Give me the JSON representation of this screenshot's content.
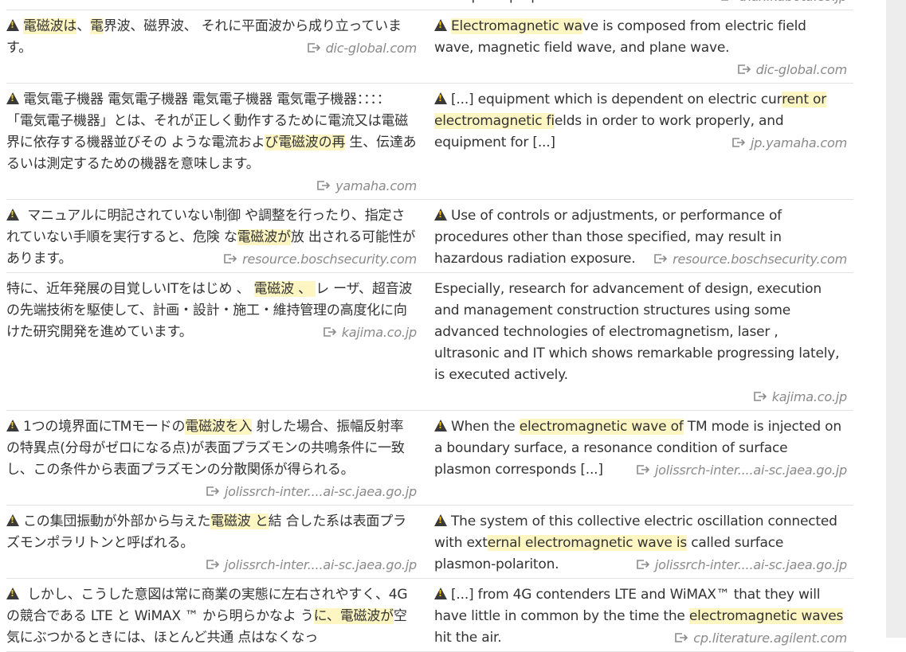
{
  "rows": [
    {
      "ja": {
        "warn": false,
        "segments": [],
        "source": ""
      },
      "en": {
        "warn": false,
        "segments": [
          {
            "t": "absorption properties and the like.",
            "h": false
          }
        ],
        "source": "txax.kubota.co.jp"
      }
    },
    {
      "ja": {
        "warn": true,
        "segments": [
          {
            "t": "電磁波は",
            "h": true
          },
          {
            "t": "、",
            "h": false
          },
          {
            "t": "電",
            "h": true
          },
          {
            "t": "界波、磁界波、 それに平面波から成り立っています。",
            "h": false
          }
        ],
        "source": "dic-global.com"
      },
      "en": {
        "warn": true,
        "segments": [
          {
            "t": "Electromagnetic wa",
            "h": true
          },
          {
            "t": "ve is composed from electric field wave, magnetic field wave, and plane wave.",
            "h": false
          }
        ],
        "source": "dic-global.com"
      }
    },
    {
      "ja": {
        "warn": true,
        "segments": [
          {
            "t": "電気電子機器 電気電子機器 電気電子機器 電気電子機器：：：： 「電気電子機器」とは、それが正しく動作するために電流又は電磁界に依存する機器並びその ような電流およ",
            "h": false
          },
          {
            "t": "び電磁波の再",
            "h": true
          },
          {
            "t": " 生、伝達あるいは測定するための機器を意味します。",
            "h": false
          }
        ],
        "source": "yamaha.com",
        "source_block": true
      },
      "en": {
        "warn": true,
        "segments": [
          {
            "t": "[...] equipment which is dependent on electric cur",
            "h": false
          },
          {
            "t": "rent or electromagnetic fi",
            "h": true
          },
          {
            "t": "elds in order to work properly, and equipment for [...]",
            "h": false
          }
        ],
        "source": "jp.yamaha.com"
      }
    },
    {
      "ja": {
        "warn": true,
        "segments": [
          {
            "t": " マニュアルに明記されていない制御 や調整を行ったり、指定されていない手順を実行すると、危険 な",
            "h": false
          },
          {
            "t": "電磁波が",
            "h": true
          },
          {
            "t": "放 出される可能性があります。",
            "h": false
          }
        ],
        "source": "resource.boschsecurity.com"
      },
      "en": {
        "warn": true,
        "segments": [
          {
            "t": "Use of controls or adjustments, or performance of procedures other than those specified, may result in hazardous radiation exposure.",
            "h": false
          }
        ],
        "source": "resource.boschsecurity.com"
      }
    },
    {
      "ja": {
        "warn": false,
        "segments": [
          {
            "t": "特に、近年発展の目覚しいITをはじめ 、 ",
            "h": false
          },
          {
            "t": "電磁波 、 ",
            "h": true
          },
          {
            "t": "レ ーザ、超音波の先端技術を駆使して、計画・設計・施工・維持管理の高度化に向けた研究開発を進めています。",
            "h": false
          }
        ],
        "source": "kajima.co.jp"
      },
      "en": {
        "warn": false,
        "segments": [
          {
            "t": "Especially, research for advancement of design, execution and management construction structures using some advanced technologies of electromagnetism, laser , ultrasonic and IT which shows remarkable progressing lately, is executed actively.",
            "h": false
          }
        ],
        "source": "kajima.co.jp",
        "source_block": true
      }
    },
    {
      "ja": {
        "warn": true,
        "segments": [
          {
            "t": "1つの境界面にTMモードの",
            "h": false
          },
          {
            "t": "電磁波を入",
            "h": true
          },
          {
            "t": " 射した場合、振幅反射率の特異点(分母がゼロになる点)が表面プラズモンの共鳴条件に一致し、この条件から表面プラズモンの分散関係が得られる。",
            "h": false
          }
        ],
        "source": "jolissrch-inter....ai-sc.jaea.go.jp"
      },
      "en": {
        "warn": true,
        "segments": [
          {
            "t": "When the ",
            "h": false
          },
          {
            "t": "electromagnetic wave of",
            "h": true
          },
          {
            "t": " TM mode is injected on a boundary surface, a resonance condition of surface plasmon corresponds [...]",
            "h": false
          }
        ],
        "source": "jolissrch-inter....ai-sc.jaea.go.jp"
      }
    },
    {
      "ja": {
        "warn": true,
        "segments": [
          {
            "t": "この集団振動が外部から与えた",
            "h": false
          },
          {
            "t": "電磁波 と",
            "h": true
          },
          {
            "t": "結 合した系は表面プラズモンポラリトンと呼ばれる。",
            "h": false
          }
        ],
        "source": "jolissrch-inter....ai-sc.jaea.go.jp",
        "source_block": true
      },
      "en": {
        "warn": true,
        "segments": [
          {
            "t": "The system of this collective electric oscillation connected with ext",
            "h": false
          },
          {
            "t": "ernal electromagnetic wave is",
            "h": true
          },
          {
            "t": " called surface plasmon-polariton.",
            "h": false
          }
        ],
        "source": "jolissrch-inter....ai-sc.jaea.go.jp"
      }
    },
    {
      "ja": {
        "warn": true,
        "segments": [
          {
            "t": " しかし、こうした意図は常に商業の実態に左右されやすく、4G の競合である LTE と WiMAX ™ から明らかなよ う",
            "h": false
          },
          {
            "t": "に、",
            "h": true
          },
          {
            "t": "",
            "h": false
          },
          {
            "t": "電磁波が",
            "h": true
          },
          {
            "t": "空 気にぶつかるときには、ほとんど共通 点はなくなっ",
            "h": false
          }
        ],
        "source": ""
      },
      "en": {
        "warn": true,
        "segments": [
          {
            "t": "[...] from 4G contenders LTE and WiMAX™ that they will have little in common by the time the ",
            "h": false
          },
          {
            "t": "electromagnetic waves",
            "h": true
          },
          {
            "t": " hit the air.",
            "h": false
          }
        ],
        "source": "cp.literature.agilent.com"
      }
    }
  ]
}
